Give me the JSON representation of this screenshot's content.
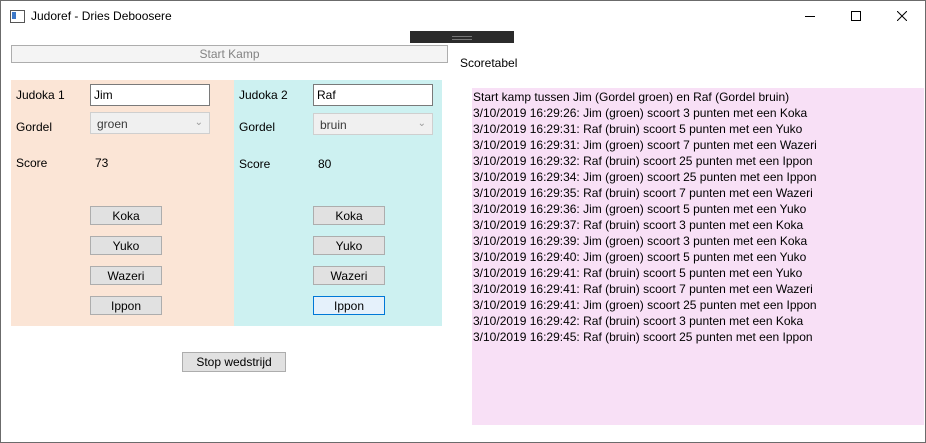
{
  "window": {
    "title": "Judoref - Dries Deboosere"
  },
  "start_button": "Start Kamp",
  "scoretabel_label": "Scoretabel",
  "judoka1": {
    "label": "Judoka 1",
    "name": "Jim",
    "gordel_label": "Gordel",
    "gordel": "groen",
    "score_label": "Score",
    "score": "73",
    "buttons": [
      "Koka",
      "Yuko",
      "Wazeri",
      "Ippon"
    ]
  },
  "judoka2": {
    "label": "Judoka 2",
    "name": "Raf",
    "gordel_label": "Gordel",
    "gordel": "bruin",
    "score_label": "Score",
    "score": "80",
    "buttons": [
      "Koka",
      "Yuko",
      "Wazeri",
      "Ippon"
    ]
  },
  "stop_button": "Stop wedstrijd",
  "log": [
    "Start kamp tussen Jim (Gordel groen) en Raf (Gordel bruin)",
    "3/10/2019 16:29:26: Jim (groen) scoort 3 punten met een Koka",
    "3/10/2019 16:29:31: Raf (bruin) scoort 5 punten met een Yuko",
    "3/10/2019 16:29:31: Jim (groen) scoort 7 punten met een Wazeri",
    "3/10/2019 16:29:32: Raf (bruin) scoort 25 punten met een Ippon",
    "3/10/2019 16:29:34: Jim (groen) scoort 25 punten met een Ippon",
    "3/10/2019 16:29:35: Raf (bruin) scoort 7 punten met een Wazeri",
    "3/10/2019 16:29:36: Jim (groen) scoort 5 punten met een Yuko",
    "3/10/2019 16:29:37: Raf (bruin) scoort 3 punten met een Koka",
    "3/10/2019 16:29:39: Jim (groen) scoort 3 punten met een Koka",
    "3/10/2019 16:29:40: Jim (groen) scoort 5 punten met een Yuko",
    "3/10/2019 16:29:41: Raf (bruin) scoort 5 punten met een Yuko",
    "3/10/2019 16:29:41: Raf (bruin) scoort 7 punten met een Wazeri",
    "3/10/2019 16:29:41: Jim (groen) scoort 25 punten met een Ippon",
    "3/10/2019 16:29:42: Raf (bruin) scoort 3 punten met een Koka",
    "3/10/2019 16:29:45: Raf (bruin) scoort 25 punten met een Ippon"
  ]
}
